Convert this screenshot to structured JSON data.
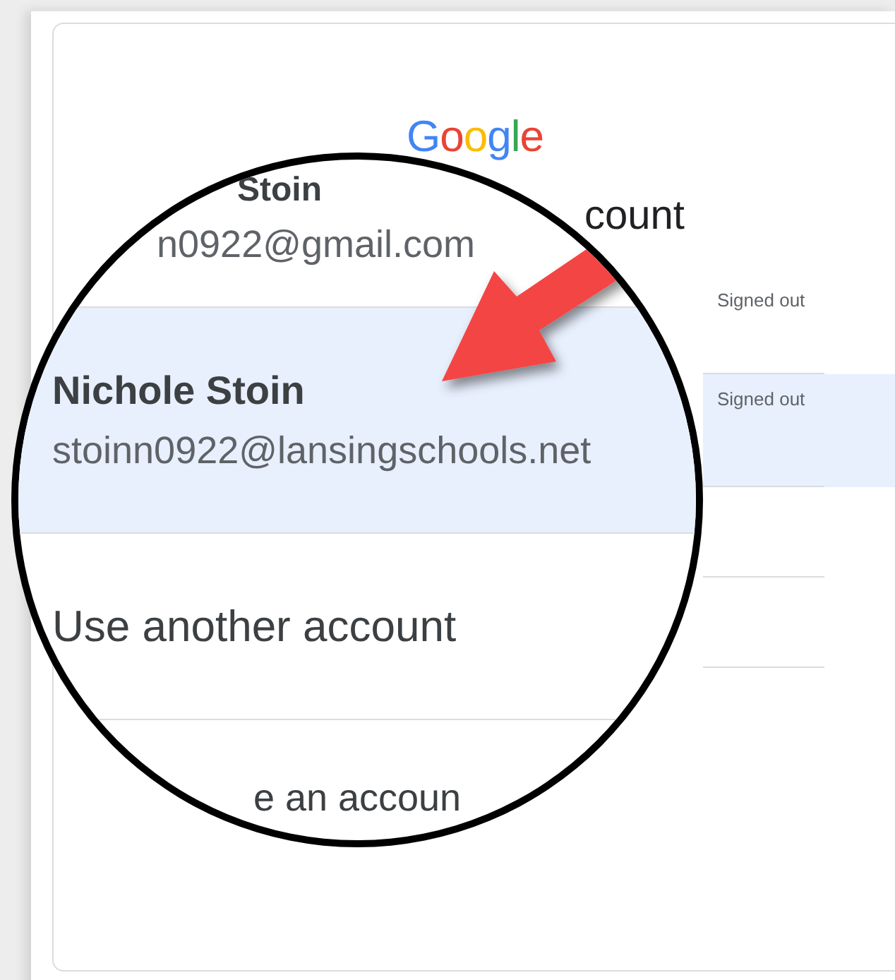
{
  "logo": "Google",
  "title": "count",
  "accounts": [
    {
      "status": "Signed out",
      "selected": false
    },
    {
      "status": "Signed out",
      "selected": true
    }
  ],
  "magnifier": {
    "accounts": [
      {
        "name": "Stoin",
        "email": "n0922@gmail.com",
        "selected": false
      },
      {
        "name": "Nichole Stoin",
        "email": "stoinn0922@lansingschools.net",
        "selected": true
      }
    ],
    "other_account": "Use another account",
    "footer": "e an accoun"
  }
}
